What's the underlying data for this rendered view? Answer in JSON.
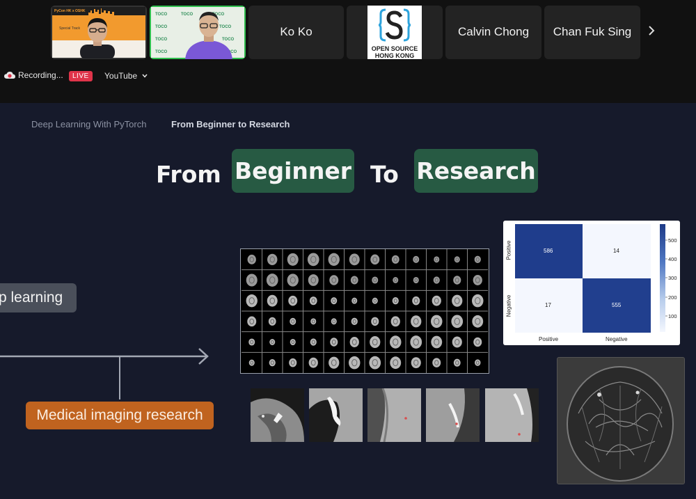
{
  "meeting": {
    "participants": [
      {
        "name": "",
        "type": "video-slide"
      },
      {
        "name": "",
        "type": "video-person"
      },
      {
        "name": "Ko Ko",
        "type": "name-only"
      },
      {
        "name": "",
        "type": "logo"
      },
      {
        "name": "Calvin Chong",
        "type": "name-only"
      },
      {
        "name": "Chan Fuk Sing",
        "type": "name-only"
      }
    ],
    "thumb_slide": {
      "title": "PyCon HK x OSHK",
      "track": "Special Track",
      "tag": "TOCO"
    },
    "logo": {
      "line1": "OPEN SOURCE",
      "line2": "HONG KONG"
    },
    "recording_label": "Recording...",
    "live_label": "LIVE",
    "stream_label": "YouTube"
  },
  "slide": {
    "breadcrumbs": [
      "Deep Learning With PyTorch",
      "From Beginner to Research"
    ],
    "headline": {
      "w1": "From",
      "w2": "Beginner",
      "w3": "To",
      "w4": "Research"
    },
    "left_tag": "p learning",
    "medical_tag": "Medical imaging research",
    "confusion_matrix": {
      "row_labels": [
        "Positive",
        "Negative"
      ],
      "col_labels": [
        "Positive",
        "Negative"
      ],
      "values": [
        [
          586,
          14
        ],
        [
          17,
          555
        ]
      ],
      "colorbar_ticks": [
        "500",
        "400",
        "300",
        "200",
        "100"
      ]
    }
  },
  "colors": {
    "slide_bg": "#161a2b",
    "pill_green": "#275a43",
    "orange_tag": "#c0631f",
    "cm_dark": "#1f3d8c",
    "cm_light": "#f4f7fe"
  }
}
